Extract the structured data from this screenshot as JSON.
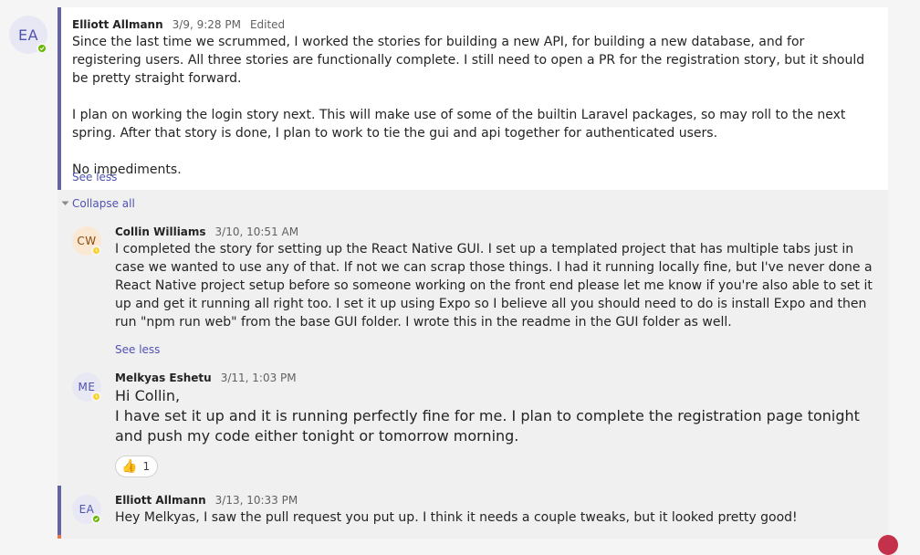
{
  "messages": {
    "root": {
      "avatar_initials": "EA",
      "author": "Elliott Allmann",
      "time": "3/9, 9:28 PM",
      "edited": "Edited",
      "paragraphs": [
        "Since the last time we scrummed, I worked the stories for building a new API, for building a new database, and for registering users. All three stories are functionally complete. I still need to open a PR for the registration story, but it should be pretty straight forward.",
        "I plan on working the login story next. This will make use of some of the builtin Laravel packages, so may roll to the next spring. After that story is done, I plan to work to tie the gui and api together for authenticated users.",
        "No impediments."
      ],
      "see_less": "See less",
      "presence": "available"
    },
    "collapse_all": "Collapse all",
    "replies": [
      {
        "avatar_initials": "CW",
        "author": "Collin Williams",
        "time": "3/10, 10:51 AM",
        "body": "I completed the story for setting up the React Native GUI. I set up a templated project that has multiple tabs just in case we wanted to use any of that. If not we can scrap those things. I had it running locally fine, but I've never done a React Native project setup before so someone working on the front end please let me know if you're also able to set it up and get it running all right too. I set it up using Expo so I believe all you should need to do is install Expo and then run \"npm run web\" from the base GUI folder. I wrote this in the readme in the GUI folder as well.",
        "see_less": "See less",
        "presence": "away"
      },
      {
        "avatar_initials": "ME",
        "author": "Melkyas Eshetu",
        "time": "3/11, 1:03 PM",
        "lines": [
          "Hi Collin,",
          "I have set it up and it is running perfectly fine for me. I plan to complete the registration page tonight and push my code either tonight or tomorrow morning."
        ],
        "reaction_emoji": "👍",
        "reaction_count": "1",
        "presence": "away"
      },
      {
        "avatar_initials": "EA",
        "author": "Elliott Allmann",
        "time": "3/13, 10:33 PM",
        "body": "Hey Melkyas, I saw the pull request you put up. I think it needs a couple tweaks, but it looked pretty good!",
        "presence": "available"
      }
    ]
  },
  "colors": {
    "accent": "#6264a7",
    "link": "#4f52b2",
    "available": "#6bb700",
    "away": "#f8d22a"
  }
}
